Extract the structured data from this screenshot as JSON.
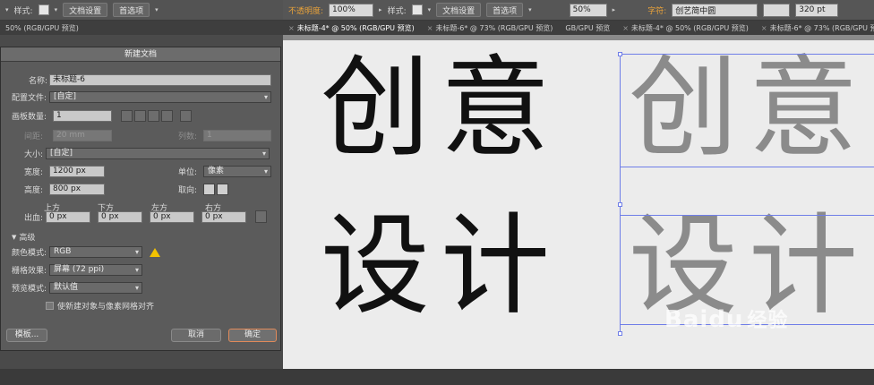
{
  "toolbar_left": {
    "style_label": "样式:",
    "doc_settings": "文档设置",
    "prefs": "首选项"
  },
  "toolbar_right": {
    "opacity_label": "不透明度:",
    "opacity_value": "100%",
    "style_label": "样式:",
    "doc_settings": "文档设置",
    "prefs": "首选项",
    "zoom_value": "50%",
    "char_label": "字符:",
    "font_value": "创艺简中圆",
    "size_value": "320 pt"
  },
  "tabs_left": [
    "50% (RGB/GPU 预览)"
  ],
  "tabs_right": [
    "未标题-4* @ 50% (RGB/GPU 预览)",
    "未标题-6* @ 73% (RGB/GPU 预览)",
    "GB/GPU 预览",
    "未标题-4* @ 50% (RGB/GPU 预览)",
    "未标题-6* @ 73% (RGB/GPU 预览)"
  ],
  "dialog": {
    "title": "新建文档",
    "name_label": "名称:",
    "name_value": "未标题-6",
    "profile_label": "配置文件:",
    "profile_value": "[自定]",
    "artboards_label": "画板数量:",
    "artboards_value": "1",
    "spacing_label": "间距:",
    "spacing_value": "20 mm",
    "columns_label": "列数:",
    "columns_value": "1",
    "size_label": "大小:",
    "size_value": "[自定]",
    "width_label": "宽度:",
    "width_value": "1200 px",
    "units_label": "单位:",
    "units_value": "像素",
    "height_label": "高度:",
    "height_value": "800 px",
    "orientation_label": "取向:",
    "bleed_label": "出血:",
    "bleed_top_label": "上方",
    "bleed_bottom_label": "下方",
    "bleed_left_label": "左方",
    "bleed_right_label": "右方",
    "bleed_top": "0 px",
    "bleed_bottom": "0 px",
    "bleed_left": "0 px",
    "bleed_right": "0 px",
    "advanced_label": "高级",
    "color_mode_label": "颜色模式:",
    "color_mode_value": "RGB",
    "raster_label": "栅格效果:",
    "raster_value": "屏幕 (72 ppi)",
    "preview_label": "预览模式:",
    "preview_value": "默认值",
    "align_pixel_label": "使新建对象与像素网格对齐",
    "templates_button": "模板...",
    "cancel_button": "取消",
    "ok_button": "确定"
  },
  "artwork": {
    "line1": "创意",
    "line2": "设计"
  },
  "watermark": {
    "brand": "Baidu",
    "suffix": "经验"
  }
}
